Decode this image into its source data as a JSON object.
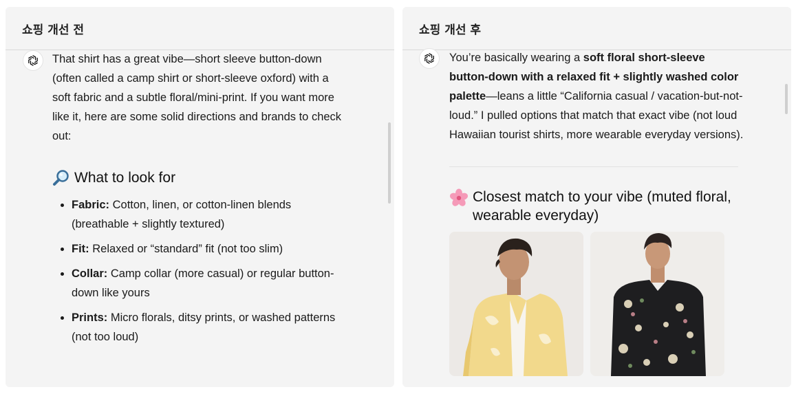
{
  "left": {
    "header": "쇼핑 개선 전",
    "intro": "That shirt has a great vibe—short sleeve button-down (often called a camp shirt or short-sleeve oxford) with a soft fabric and a subtle floral/mini-print. If you want more like it, here are some solid directions and brands to check out:",
    "section_icon": "magnifying-glass-icon",
    "section_title": "What to look for",
    "bullets": [
      {
        "label": "Fabric:",
        "text": " Cotton, linen, or cotton-linen blends (breathable + slightly textured)"
      },
      {
        "label": "Fit:",
        "text": " Relaxed or “standard” fit (not too slim)"
      },
      {
        "label": "Collar:",
        "text": " Camp collar (more casual) or regular button-down like yours"
      },
      {
        "label": "Prints:",
        "text": " Micro florals, ditsy prints, or washed patterns (not too loud)"
      }
    ]
  },
  "right": {
    "header": "쇼핑 개선 후",
    "intro_pre": "You’re basically wearing a ",
    "intro_bold": "soft floral short-sleeve button-down with a relaxed fit + slightly washed color palette",
    "intro_post": "—leans a little “California casual / vacation-but-not-loud.” I pulled options that match that exact vibe (not loud Hawaiian tourist shirts, more wearable everyday versions).",
    "section_icon": "cherry-blossom-icon",
    "section_title": "Closest match to your vibe (muted floral, wearable everyday)",
    "products": [
      {
        "image": "yellow-floral-camp-shirt-photo"
      },
      {
        "image": "black-floral-short-sleeve-shirt-photo"
      }
    ]
  },
  "colors": {
    "panel_bg": "#f4f4f4",
    "divider": "#d9d9d9",
    "text": "#1a1a1a"
  }
}
